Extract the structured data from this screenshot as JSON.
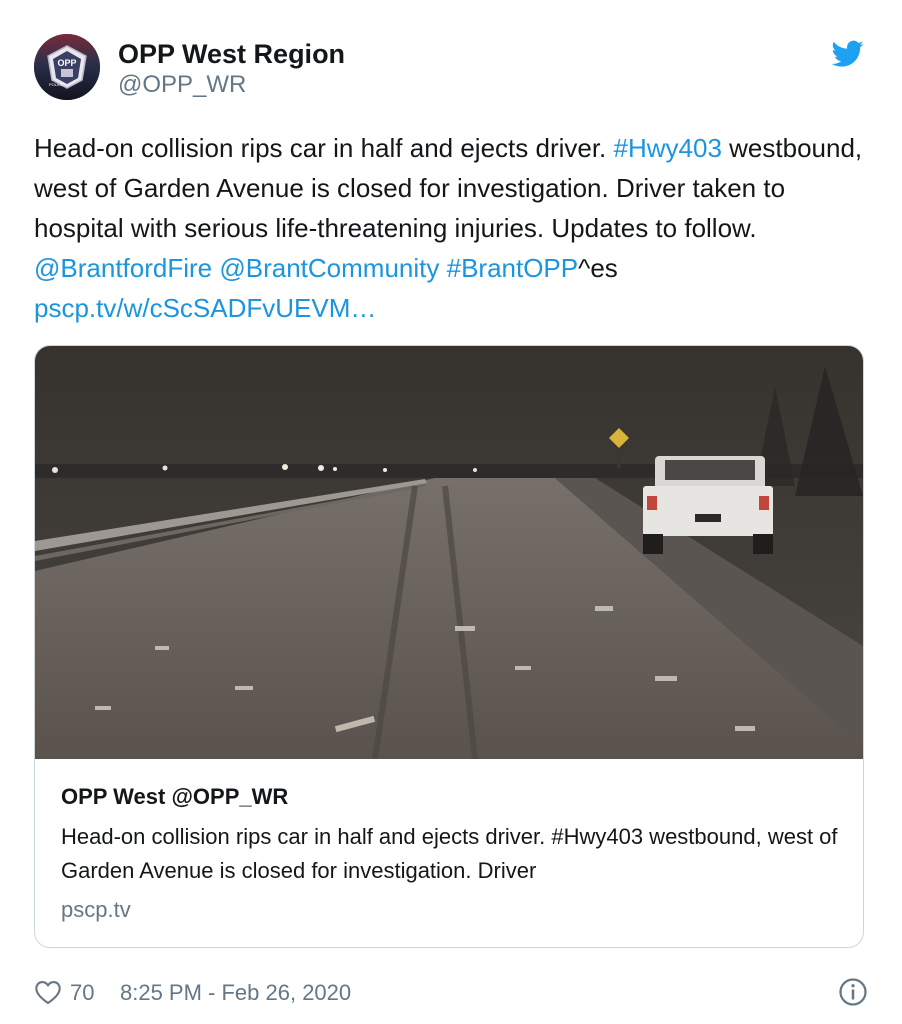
{
  "author": {
    "display_name": "OPP West Region",
    "handle": "@OPP_WR",
    "avatar_icon": "opp-badge-avatar",
    "avatar_text": "OPP",
    "avatar_small_text": "POLICE"
  },
  "tweet": {
    "text_part1": "Head-on collision rips car in half and ejects driver. ",
    "hashtag1": "#Hwy403",
    "text_part2": " westbound, west of Garden Avenue is closed for investigation. Driver taken to hospital with serious life-threatening injuries. Updates to follow.  ",
    "mention1": "@BrantfordFire",
    "mention2": "@BrantCommunity",
    "hashtag2": "#BrantOPP",
    "text_part3": "^es ",
    "link": "pscp.tv/w/cScSADFvUEVM…"
  },
  "card": {
    "title": "OPP West @OPP_WR",
    "description": "Head-on collision rips car in half and ejects driver. #Hwy403 westbound, west of Garden Avenue is closed for investigation. Driver",
    "domain": "pscp.tv",
    "image_icon": "highway-night-scene-photo"
  },
  "footer": {
    "likes": "70",
    "timestamp": "8:25 PM - Feb 26, 2020"
  },
  "colors": {
    "link": "#1b95e0",
    "secondary_text": "#657786",
    "border": "#ccd6dd"
  }
}
